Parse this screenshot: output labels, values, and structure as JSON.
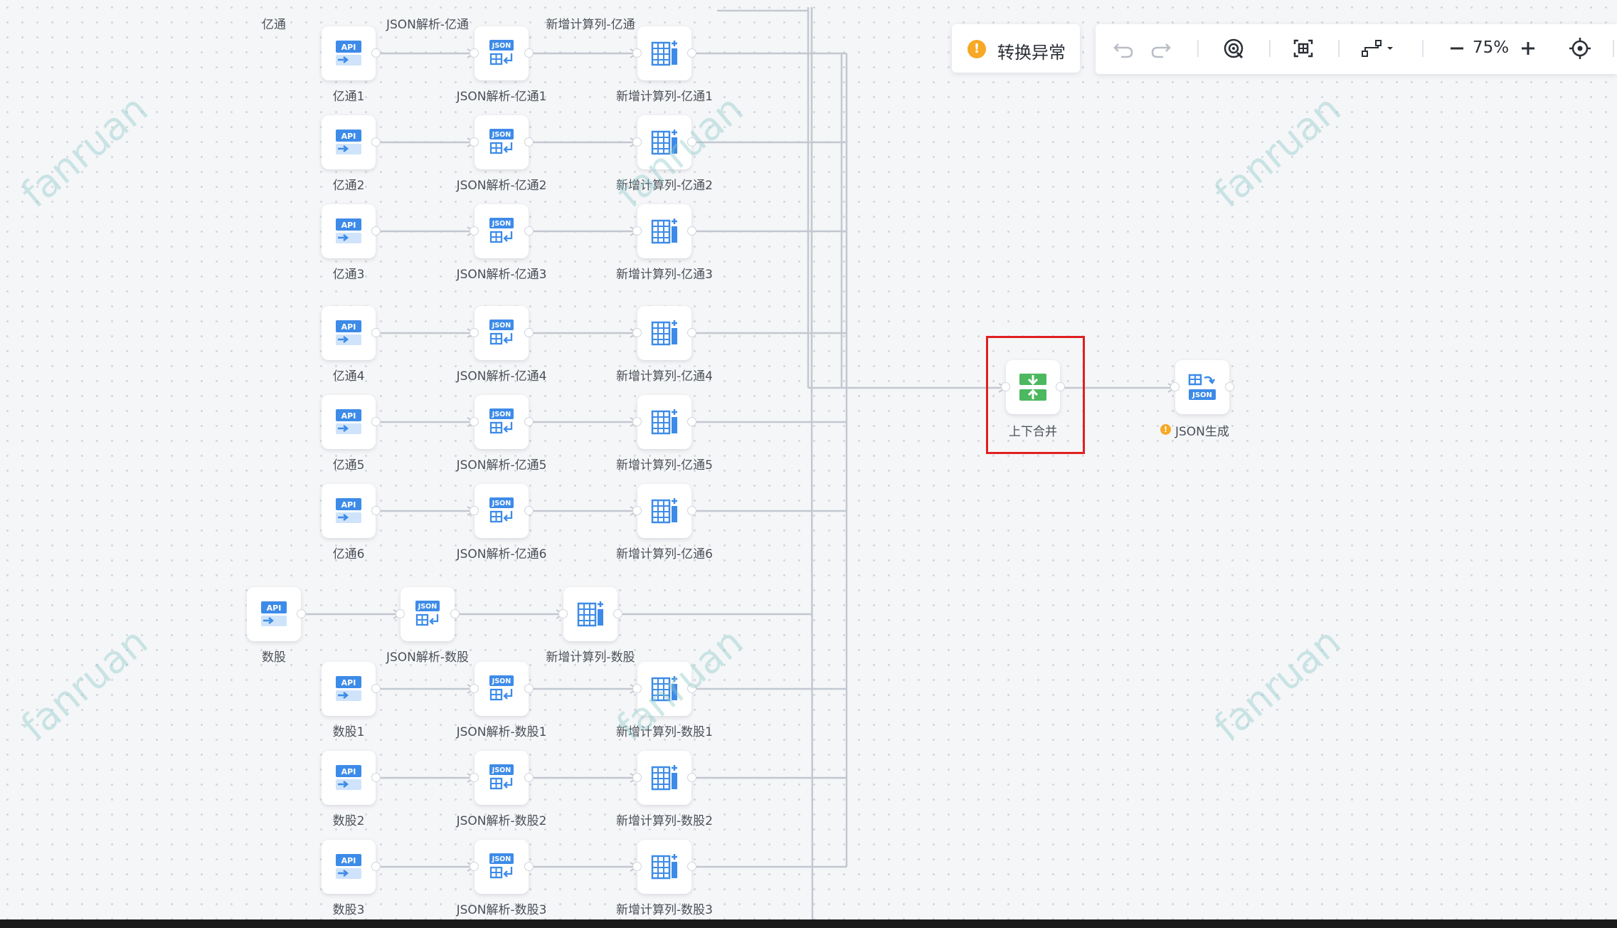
{
  "status": {
    "icon": "warning-icon",
    "text": "转换异常"
  },
  "toolbar": {
    "zoom_level": "75%",
    "icons": [
      "undo-icon",
      "redo-icon",
      "preview-icon",
      "fit-screen-icon",
      "layout-icon",
      "zoom-out-icon",
      "zoom-in-icon",
      "locate-icon"
    ]
  },
  "colors": {
    "accent_blue": "#3d8be8",
    "merge_green": "#4cb85f",
    "warning": "#f7a825",
    "highlight": "#e02020"
  },
  "watermark": "fanruan",
  "top_labels": [
    "亿通",
    "JSON解析-亿通",
    "新增计算列-亿通"
  ],
  "rows": [
    {
      "api": "亿通1",
      "json": "JSON解析-亿通1",
      "calc": "新增计算列-亿通1"
    },
    {
      "api": "亿通2",
      "json": "JSON解析-亿通2",
      "calc": "新增计算列-亿通2"
    },
    {
      "api": "亿通3",
      "json": "JSON解析-亿通3",
      "calc": "新增计算列-亿通3"
    },
    {
      "api": "亿通4",
      "json": "JSON解析-亿通4",
      "calc": "新增计算列-亿通4"
    },
    {
      "api": "亿通5",
      "json": "JSON解析-亿通5",
      "calc": "新增计算列-亿通5"
    },
    {
      "api": "亿通6",
      "json": "JSON解析-亿通6",
      "calc": "新增计算列-亿通6"
    },
    {
      "api": "数股",
      "json": "JSON解析-数股",
      "calc": "新增计算列-数股"
    },
    {
      "api": "数股1",
      "json": "JSON解析-数股1",
      "calc": "新增计算列-数股1"
    },
    {
      "api": "数股2",
      "json": "JSON解析-数股2",
      "calc": "新增计算列-数股2"
    },
    {
      "api": "数股3",
      "json": "JSON解析-数股3",
      "calc": "新增计算列-数股3"
    }
  ],
  "merge_node": {
    "label": "上下合并"
  },
  "json_gen_node": {
    "label": "JSON生成",
    "has_warning": true
  }
}
